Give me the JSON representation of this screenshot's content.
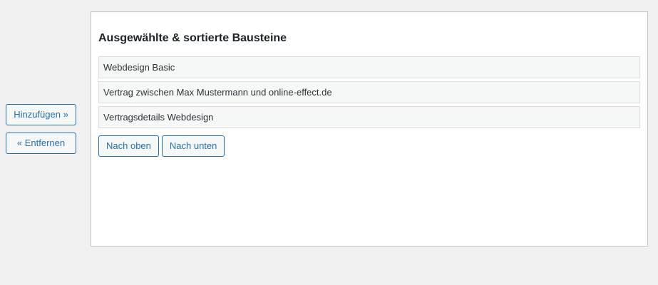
{
  "actions": {
    "add_label": "Hinzufügen »",
    "remove_label": "« Entfernen"
  },
  "selected_panel": {
    "title": "Ausgewählte & sortierte Bausteine",
    "items": [
      {
        "label": "Webdesign Basic"
      },
      {
        "label": "Vertrag zwischen Max Mustermann und online-effect.de"
      },
      {
        "label": "Vertragsdetails Webdesign"
      }
    ],
    "move_up_label": "Nach oben",
    "move_down_label": "Nach unten"
  },
  "colors": {
    "accent": "#2271b1",
    "page_background": "#f0f0f1",
    "panel_background": "#ffffff",
    "item_background": "#f6f7f7",
    "border": "#c3c4c7"
  }
}
